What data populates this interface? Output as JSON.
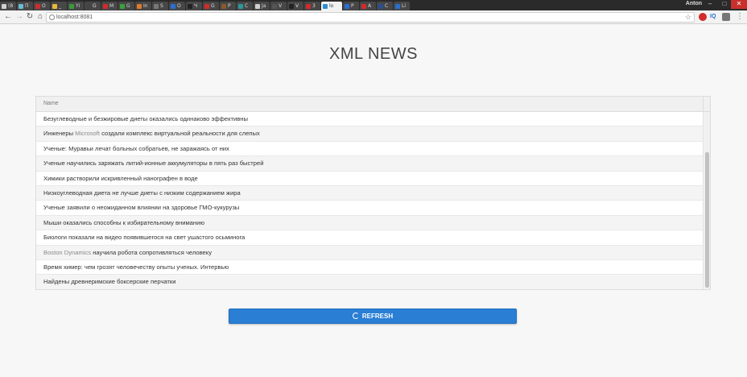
{
  "browser": {
    "tabs": [
      {
        "label": "(8",
        "color": "#d0d0d0"
      },
      {
        "label": "П",
        "color": "#6bbbd6"
      },
      {
        "label": "O",
        "color": "#d12b2b"
      },
      {
        "label": "_",
        "color": "#e8b83a"
      },
      {
        "label": "Yi",
        "color": "#3a9a3a"
      },
      {
        "label": "G",
        "color": "#444444"
      },
      {
        "label": "M",
        "color": "#d12b2b"
      },
      {
        "label": "G",
        "color": "#3aa03a"
      },
      {
        "label": "In",
        "color": "#e07a2a"
      },
      {
        "label": "S",
        "color": "#777777"
      },
      {
        "label": "O",
        "color": "#2a6fd1"
      },
      {
        "label": "Ч",
        "color": "#222222"
      },
      {
        "label": "G",
        "color": "#d12b2b"
      },
      {
        "label": "P",
        "color": "#8a5a2a"
      },
      {
        "label": "C",
        "color": "#2a9a9a"
      },
      {
        "label": "Ja",
        "color": "#d0d0d0"
      },
      {
        "label": "V",
        "color": "#555555"
      },
      {
        "label": "V",
        "color": "#222222"
      },
      {
        "label": "3",
        "color": "#d12b2b"
      },
      {
        "label": "lo",
        "color": "#2a8fd1",
        "active": true
      },
      {
        "label": "P",
        "color": "#2a6fd1"
      },
      {
        "label": "A",
        "color": "#d12b2b"
      },
      {
        "label": "C",
        "color": "#2a4f91"
      },
      {
        "label": "Li",
        "color": "#2a6fd1"
      }
    ],
    "user_name": "Anton",
    "url": "localhost:8081"
  },
  "page": {
    "title": "XML NEWS",
    "table": {
      "column_header": "Name",
      "rows": [
        {
          "text": "Безуглеводные и безжировые диеты оказались одинаково эффективны"
        },
        {
          "prefix": "Инженеры ",
          "muted": "Microsoft",
          "suffix": " создали комплекс виртуальной реальности для слепых"
        },
        {
          "text": "Ученые: Муравьи лечат больных собратьев, не заражаясь от них"
        },
        {
          "text": "Ученые научились заряжать литий-ионные аккумуляторы в пять раз быстрей"
        },
        {
          "text": "Химики растворили искривленный нанографен в воде"
        },
        {
          "text": "Низкоуглеводная диета не лучше диеты с низким содержанием жира"
        },
        {
          "text": "Ученые заявили о неожиданном влиянии на здоровье ГМО-кукурузы"
        },
        {
          "text": "Мыши оказались способны к избирательному вниманию"
        },
        {
          "text": "Биологи показали на видео появившегося на свет ушастого осьминога"
        },
        {
          "prefix": "",
          "muted": "Boston Dynamics",
          "suffix": " научила робота сопротивляться человеку"
        },
        {
          "text": "Время химер: чем грозят человечеству опыты ученых. Интервью"
        },
        {
          "text": "Найдены древнеримские боксерские перчатки"
        }
      ]
    },
    "refresh_label": "REFRESH"
  }
}
